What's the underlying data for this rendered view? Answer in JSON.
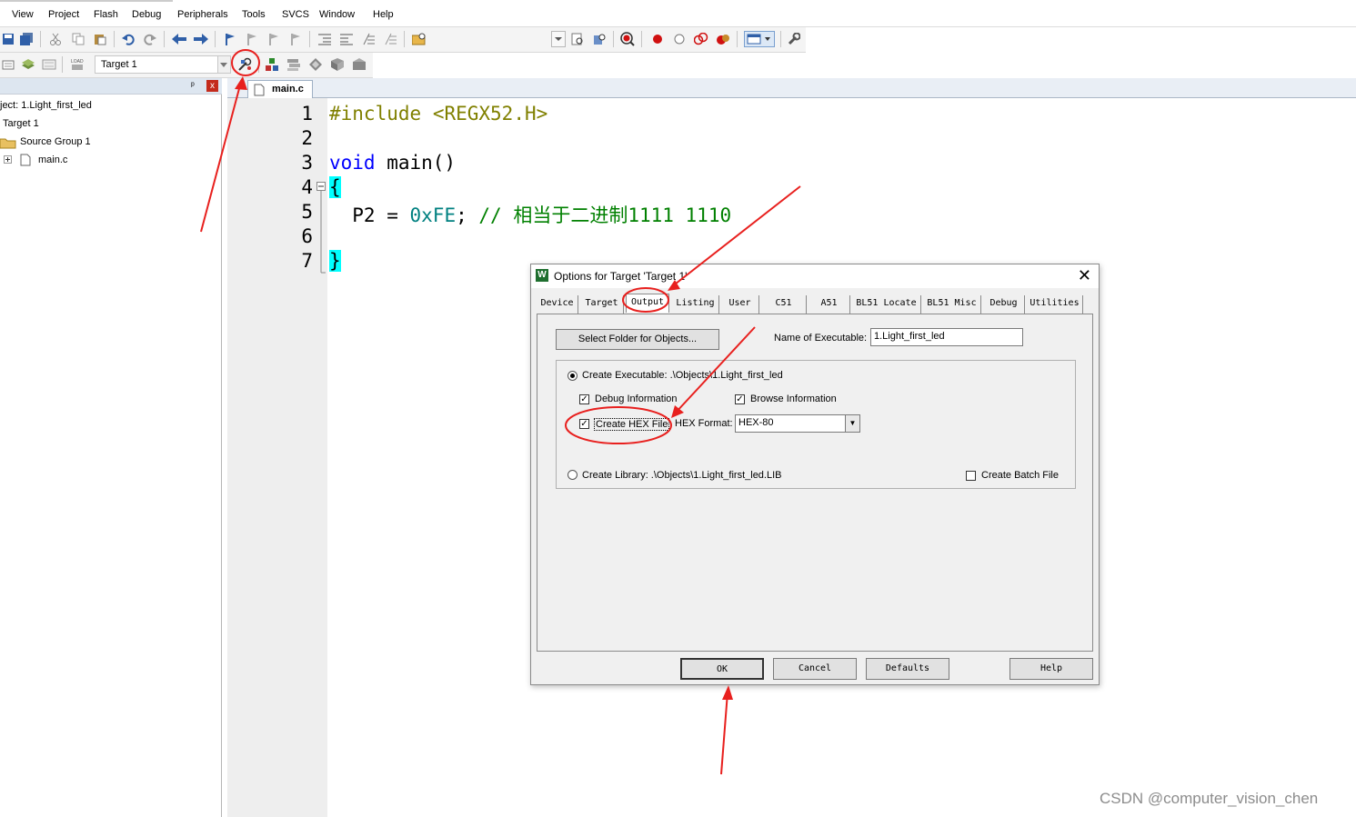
{
  "menu": [
    "View",
    "Project",
    "Flash",
    "Debug",
    "Peripherals",
    "Tools",
    "SVCS",
    "Window",
    "Help"
  ],
  "toolbar": {
    "target_select": "Target 1",
    "icons": [
      "save-icon",
      "save-all-icon",
      "cut-icon",
      "copy-icon",
      "paste-icon",
      "undo-icon",
      "redo-icon",
      "nav-back-icon",
      "nav-forward-icon",
      "bookmark-icon",
      "indent-icon",
      "unindent-icon",
      "comment-icon",
      "uncomment-icon",
      "find-in-files-icon",
      "debug-start-icon",
      "breakpoint-icon",
      "breakpoint-disable-icon",
      "breakpoint-kill-icon",
      "window-layout-icon",
      "configure-icon",
      "translate-icon",
      "build-icon",
      "rebuild-icon",
      "download-icon",
      "options-for-target-icon",
      "manage-components-icon"
    ]
  },
  "project_panel": {
    "pin": "ᵖ",
    "close": "x",
    "tree": {
      "project": "ject: 1.Light_first_led",
      "target": "Target 1",
      "group": "Source Group 1",
      "file": "main.c"
    }
  },
  "editor": {
    "tab": "main.c",
    "line_numbers": [
      "1",
      "2",
      "3",
      "4",
      "5",
      "6",
      "7"
    ],
    "code": {
      "l1_pp": "#include",
      "l1_hdr": "<REGX52.H>",
      "l3_kw": "void",
      "l3_rest": " main()",
      "l4": "{",
      "l5_lhs": "  P2 = ",
      "l5_num": "0xFE",
      "l5_semi": "; ",
      "l5_cmt": "// 相当于二进制1111 1110",
      "l7": "}"
    }
  },
  "dialog": {
    "title": "Options for Target 'Target 1'",
    "close": "✕",
    "tabs": [
      "Device",
      "Target",
      "Output",
      "Listing",
      "User",
      "C51",
      "A51",
      "BL51 Locate",
      "BL51 Misc",
      "Debug",
      "Utilities"
    ],
    "active_tab": "Output",
    "select_folder_button": "Select Folder for Objects...",
    "name_of_executable_label": "Name of Executable:",
    "name_of_executable_value": "1.Light_first_led",
    "create_executable": "Create Executable:  .\\Objects\\1.Light_first_led",
    "debug_information": "Debug Information",
    "browse_information": "Browse Information",
    "create_hex_file": "Create HEX File",
    "hex_format_label": "HEX Format:",
    "hex_format_value": "HEX-80",
    "create_library": "Create Library:  .\\Objects\\1.Light_first_led.LIB",
    "create_batch_file": "Create Batch File",
    "buttons": {
      "ok": "OK",
      "cancel": "Cancel",
      "defaults": "Defaults",
      "help": "Help"
    }
  },
  "watermark": "CSDN @computer_vision_chen",
  "colors": {
    "annotation": "#e8201e",
    "keyword": "#0000ff",
    "preprocessor": "#808000",
    "number": "#008080",
    "comment": "#008000",
    "brace_highlight": "#00ffff"
  }
}
